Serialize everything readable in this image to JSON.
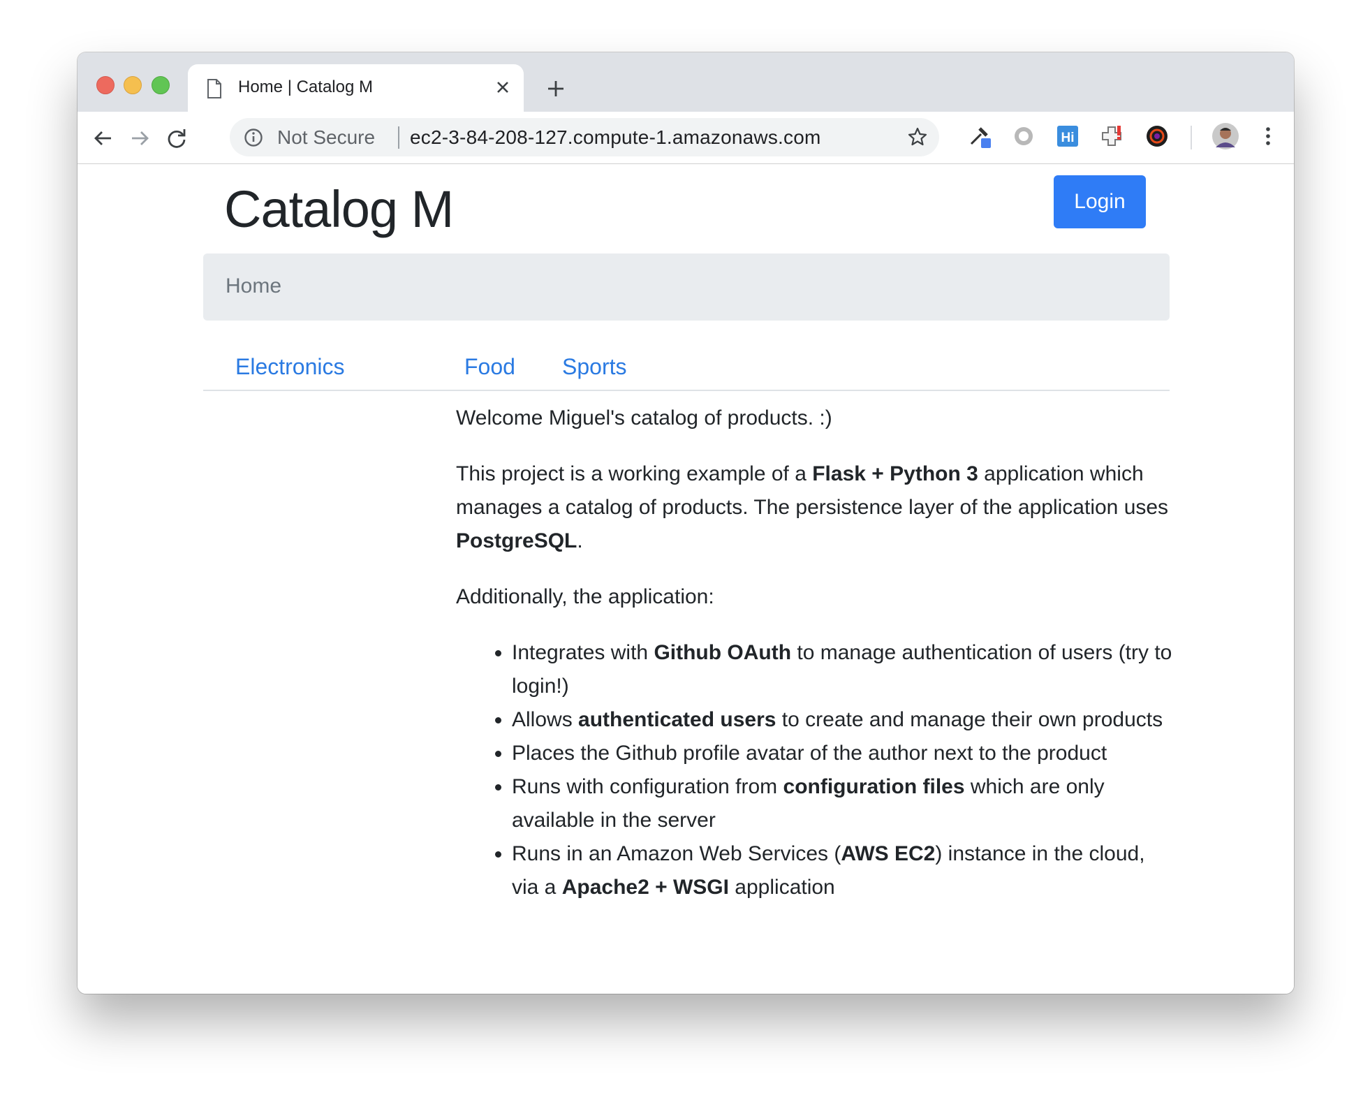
{
  "browser": {
    "tab_title": "Home | Catalog M",
    "security_label": "Not Secure",
    "url": "ec2-3-84-208-127.compute-1.amazonaws.com"
  },
  "site": {
    "title": "Catalog M",
    "login_label": "Login",
    "breadcrumb": "Home",
    "categories": [
      "Electronics",
      "Food",
      "Sports"
    ]
  },
  "content": {
    "welcome": "Welcome Miguel's catalog of products. :)",
    "intro_1": "This project is a working example of a ",
    "intro_bold_1": "Flask + Python 3",
    "intro_2": " application which manages a catalog of products. The persistence layer of the application uses ",
    "intro_bold_2": "PostgreSQL",
    "intro_3": ".",
    "additionally": "Additionally, the application:",
    "f1_a": "Integrates with ",
    "f1_b": "Github OAuth",
    "f1_c": " to manage authentication of users (try to login!)",
    "f2_a": "Allows ",
    "f2_b": "authenticated users",
    "f2_c": " to create and manage their own products",
    "f3": "Places the Github profile avatar of the author next to the product",
    "f4_a": "Runs with configuration from ",
    "f4_b": "configuration files",
    "f4_c": " which are only available in the server",
    "f5_a": "Runs in an Amazon Web Services (",
    "f5_b": "AWS EC2",
    "f5_c": ") instance in the cloud, via a ",
    "f5_d": "Apache2 + WSGI",
    "f5_e": " application"
  },
  "colors": {
    "accent": "#2f7cf6",
    "link": "#2a7ae2",
    "breadcrumb_bg": "#e9ecef"
  }
}
